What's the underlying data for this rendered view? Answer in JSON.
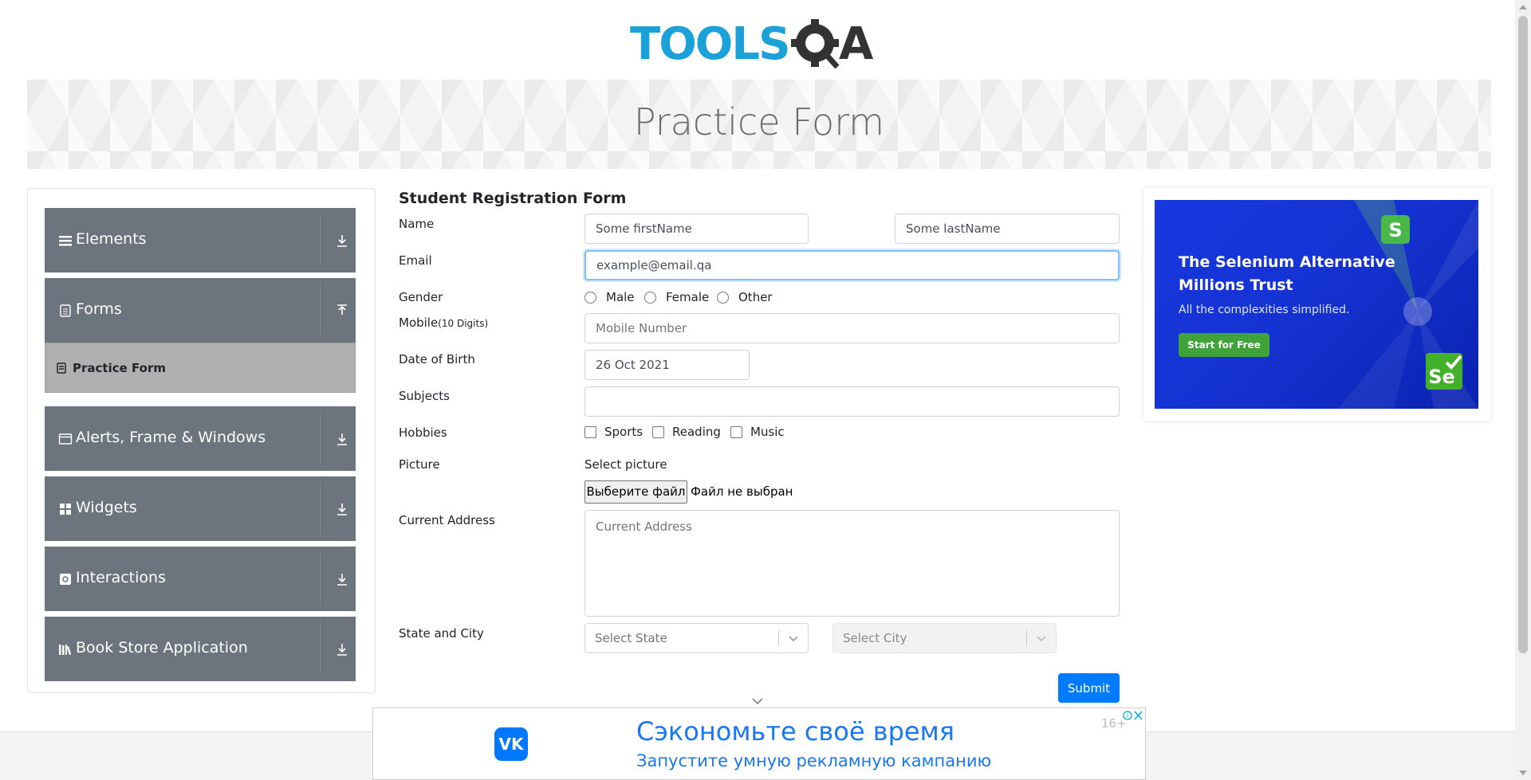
{
  "header": {
    "logo_text": "TOOLSQA",
    "page_title": "Practice Form"
  },
  "sidebar": {
    "groups": [
      {
        "label": "Elements",
        "icon": "hamburger-icon",
        "arrow": "download-arrow-icon"
      },
      {
        "label": "Forms",
        "icon": "document-icon",
        "arrow": "upload-arrow-icon"
      },
      {
        "label": "Alerts, Frame & Windows",
        "icon": "window-icon",
        "arrow": "download-arrow-icon"
      },
      {
        "label": "Widgets",
        "icon": "widgets-icon",
        "arrow": "download-arrow-icon"
      },
      {
        "label": "Interactions",
        "icon": "interactions-icon",
        "arrow": "download-arrow-icon"
      },
      {
        "label": "Book Store Application",
        "icon": "books-icon",
        "arrow": "download-arrow-icon"
      }
    ],
    "active_item": {
      "label": "Practice Form",
      "icon": "form-icon"
    }
  },
  "form": {
    "title": "Student Registration Form",
    "labels": {
      "name": "Name",
      "email": "Email",
      "gender": "Gender",
      "mobile": "Mobile",
      "mobile_hint": "(10 Digits)",
      "dob": "Date of Birth",
      "subjects": "Subjects",
      "hobbies": "Hobbies",
      "picture": "Picture",
      "address": "Current Address",
      "state_city": "State and City"
    },
    "first_name_value": "Some firstName",
    "last_name_value": "Some lastName",
    "email_value": "example@email.qa",
    "gender_options": [
      "Male",
      "Female",
      "Other"
    ],
    "mobile_placeholder": "Mobile Number",
    "dob_value": "26 Oct 2021",
    "subjects_value": "",
    "hobby_options": [
      "Sports",
      "Reading",
      "Music"
    ],
    "picture_label": "Select picture",
    "file_button": "Выберите файл",
    "file_status": "Файл не выбран",
    "address_placeholder": "Current Address",
    "state_placeholder": "Select State",
    "city_placeholder": "Select City",
    "submit": "Submit"
  },
  "right_ad": {
    "headline_line1": "The Selenium Alternative",
    "headline_line2": "Millions Trust",
    "subtext": "All the complexities simplified.",
    "button": "Start for Free",
    "accent": "#1838e0"
  },
  "bottom_ad": {
    "brand": "VK",
    "headline": "Сэкономьте своё время",
    "subheadline": "Запустите умную рекламную кампанию",
    "age_rating": "16+"
  }
}
